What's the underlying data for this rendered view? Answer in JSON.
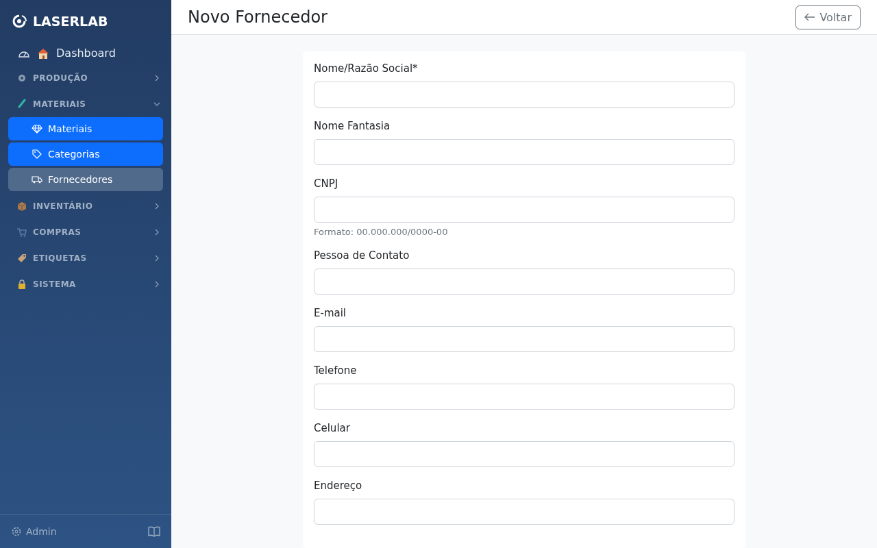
{
  "brand": "LASERLAB",
  "sidebar": {
    "dashboard": "Dashboard",
    "sections": [
      {
        "label": "PRODUÇÃO",
        "expanded": false
      },
      {
        "label": "MATERIAIS",
        "expanded": true,
        "items": [
          {
            "label": "Materiais",
            "selected": true,
            "hovered": false
          },
          {
            "label": "Categorias",
            "selected": true,
            "hovered": false
          },
          {
            "label": "Fornecedores",
            "selected": false,
            "hovered": true
          }
        ]
      },
      {
        "label": "INVENTÁRIO",
        "expanded": false
      },
      {
        "label": "COMPRAS",
        "expanded": false
      },
      {
        "label": "ETIQUETAS",
        "expanded": false
      },
      {
        "label": "SISTEMA",
        "expanded": false
      }
    ],
    "user": "Admin"
  },
  "page": {
    "title": "Novo Fornecedor",
    "back_button": "Voltar"
  },
  "form": {
    "fields": [
      {
        "label": "Nome/Razão Social*"
      },
      {
        "label": "Nome Fantasia"
      },
      {
        "label": "CNPJ",
        "help": "Formato: 00.000.000/0000-00"
      },
      {
        "label": "Pessoa de Contato"
      },
      {
        "label": "E-mail"
      },
      {
        "label": "Telefone"
      },
      {
        "label": "Celular"
      },
      {
        "label": "Endereço"
      }
    ]
  }
}
